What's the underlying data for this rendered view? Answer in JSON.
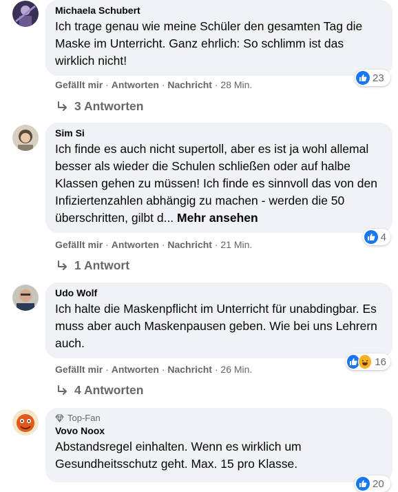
{
  "actions": {
    "like": "Gefällt mir",
    "reply": "Antworten",
    "message": "Nachricht",
    "sep": "·"
  },
  "comments": [
    {
      "author": "Michaela Schubert",
      "text": "Ich trage genau wie meine Schüler den gesamten Tag die Maske im Unterricht. Ganz ehrlich: So schlimm ist das wirklich nicht!",
      "time": "28 Min.",
      "reaction_count": "23",
      "replies": "3 Antworten"
    },
    {
      "author": "Sim Si",
      "text": "Ich finde es auch nicht supertoll, aber es ist ja wohl allemal besser als wieder die Schulen schließen oder auf halbe Klassen gehen zu müssen! Ich finde es sinnvoll das von den Infiziertenzahlen abhängig zu machen - werden die 50 überschritten, gilbt d...",
      "more": "Mehr ansehen",
      "time": "21 Min.",
      "reaction_count": "4",
      "replies": "1 Antwort"
    },
    {
      "author": "Udo Wolf",
      "text": "Ich halte die Maskenpflicht im Unterricht für unabdingbar. Es muss aber auch Maskenpausen geben. Wie bei uns Lehrern auch.",
      "time": "26 Min.",
      "reaction_count": "16",
      "replies": "4 Antworten"
    },
    {
      "badge": "Top-Fan",
      "author": "Vovo Noox",
      "text": "Abstandsregel einhalten. Wenn es wirklich um Gesundheitsschutz geht. Max. 15 pro Klasse.",
      "reaction_count": "20"
    }
  ],
  "colors": {
    "like": "#1877f2",
    "haha": "#f7b125",
    "bubble": "#f0f2f5",
    "meta": "#65676b"
  }
}
